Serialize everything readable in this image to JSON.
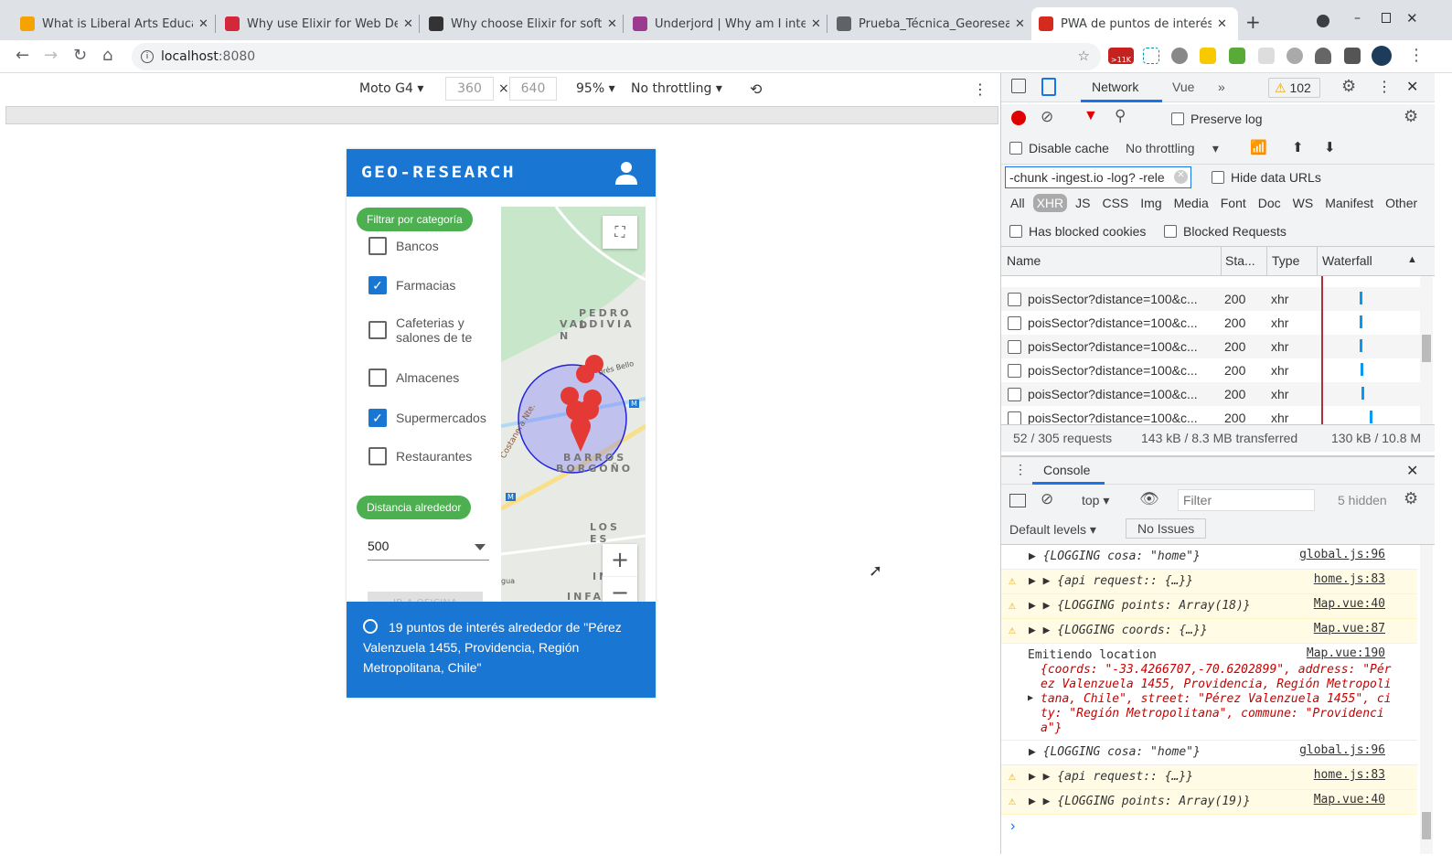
{
  "browser": {
    "tabs": [
      {
        "title": "What is Liberal Arts Educati",
        "color": "#f5a300",
        "active": false
      },
      {
        "title": "Why use Elixir for Web Deve",
        "color": "#d3283a",
        "active": false
      },
      {
        "title": "Why choose Elixir for softw",
        "color": "#333333",
        "active": false
      },
      {
        "title": "Underjord | Why am I intere",
        "color": "#9b3b8f",
        "active": false
      },
      {
        "title": "Prueba_Técnica_Georesearc",
        "color": "#5f6368",
        "active": false
      },
      {
        "title": "PWA de puntos de interés",
        "color": "#d52b1e",
        "active": true
      }
    ],
    "url_host": "localhost",
    "url_port": ":8080",
    "gmail_badge": ">11K"
  },
  "device_toolbar": {
    "device": "Moto G4",
    "width": "360",
    "height": "640",
    "times": "×",
    "zoom": "95%",
    "throttling": "No throttling"
  },
  "app": {
    "logo": "GEO-RESEARCH",
    "filter_chip": "Filtrar por categoría",
    "categories": [
      {
        "label": "Bancos",
        "checked": false
      },
      {
        "label": "Farmacias",
        "checked": true
      },
      {
        "label": "Cafeterias y salones de te",
        "checked": false
      },
      {
        "label": "Almacenes",
        "checked": false
      },
      {
        "label": "Supermercados",
        "checked": true
      },
      {
        "label": "Restaurantes",
        "checked": false
      }
    ],
    "distance_chip": "Distancia alrededor",
    "distance_value": "500",
    "office_button": "IR A OFICINA",
    "map_labels": {
      "l1": "PEDRO D",
      "l2": "VALDIVIA N",
      "l3": "BARROS",
      "l4": "BORGOÑO",
      "l5": "LOS ES",
      "l6": "INFANTE",
      "l7": "Costanera Nte.",
      "l8": "drés Bello",
      "l9": "gua",
      "l10": "IN",
      "metro": "M"
    },
    "zoom_in": "+",
    "zoom_out": "−",
    "footer": "19 puntos de interés alrededor de \"Pérez Valenzuela 1455, Providencia, Región Metropolitana, Chile\""
  },
  "devtools": {
    "tabs": [
      "Network",
      "Vue",
      "»"
    ],
    "warnings": "102",
    "preserve_log": "Preserve log",
    "disable_cache": "Disable cache",
    "throttling": "No throttling",
    "filter_value": "-chunk -ingest.io -log? -rele",
    "hide_data_urls": "Hide data URLs",
    "types": [
      "All",
      "XHR",
      "JS",
      "CSS",
      "Img",
      "Media",
      "Font",
      "Doc",
      "WS",
      "Manifest",
      "Other"
    ],
    "active_type": "XHR",
    "has_blocked": "Has blocked cookies",
    "blocked_requests": "Blocked Requests",
    "columns": [
      "Name",
      "Sta...",
      "Type",
      "Waterfall"
    ],
    "requests": [
      {
        "name": "poisSector?distance=100&c...",
        "status": "200",
        "type": "xhr"
      },
      {
        "name": "poisSector?distance=100&c...",
        "status": "200",
        "type": "xhr"
      },
      {
        "name": "poisSector?distance=100&c...",
        "status": "200",
        "type": "xhr"
      },
      {
        "name": "poisSector?distance=100&c...",
        "status": "200",
        "type": "xhr"
      },
      {
        "name": "poisSector?distance=100&c...",
        "status": "200",
        "type": "xhr"
      },
      {
        "name": "poisSector?distance=100&c...",
        "status": "200",
        "type": "xhr"
      }
    ],
    "summary": {
      "requests": "52 / 305 requests",
      "transferred": "143 kB / 8.3 MB transferred",
      "resources": "130 kB / 10.8 M"
    },
    "console": {
      "title": "Console",
      "context": "top",
      "filter_placeholder": "Filter",
      "hidden": "5 hidden",
      "levels": "Default levels",
      "issues": "No Issues",
      "messages": [
        {
          "warn": false,
          "text": "▶ {LOGGING cosa: \"home\"}",
          "src": "global.js:96"
        },
        {
          "warn": true,
          "text": "▶ ▶ {api request:: {…}}",
          "src": "home.js:83"
        },
        {
          "warn": true,
          "text": "▶ ▶ {LOGGING points: Array(18)}",
          "src": "Map.vue:40"
        },
        {
          "warn": true,
          "text": "▶ ▶ {LOGGING coords: {…}}",
          "src": "Map.vue:87"
        },
        {
          "warn": false,
          "text": "Emitiendo location",
          "src": "Map.vue:190",
          "detail": "{coords: \"-33.4266707,-70.6202899\", address: \"Pérez Valenzuela 1455, Providencia, Región Metropolitana, Chile\", street: \"Pérez Valenzuela 1455\", city: \"Región Metropolitana\", commune: \"Providencia\"}"
        },
        {
          "warn": false,
          "text": "▶ {LOGGING cosa: \"home\"}",
          "src": "global.js:96"
        },
        {
          "warn": true,
          "text": "▶ ▶ {api request:: {…}}",
          "src": "home.js:83"
        },
        {
          "warn": true,
          "text": "▶ ▶ {LOGGING points: Array(19)}",
          "src": "Map.vue:40"
        }
      ]
    }
  },
  "colors": {
    "primary": "#1976d2",
    "chip": "#4caf50",
    "record": "#e00000",
    "warn_bg": "#fffbe5"
  }
}
